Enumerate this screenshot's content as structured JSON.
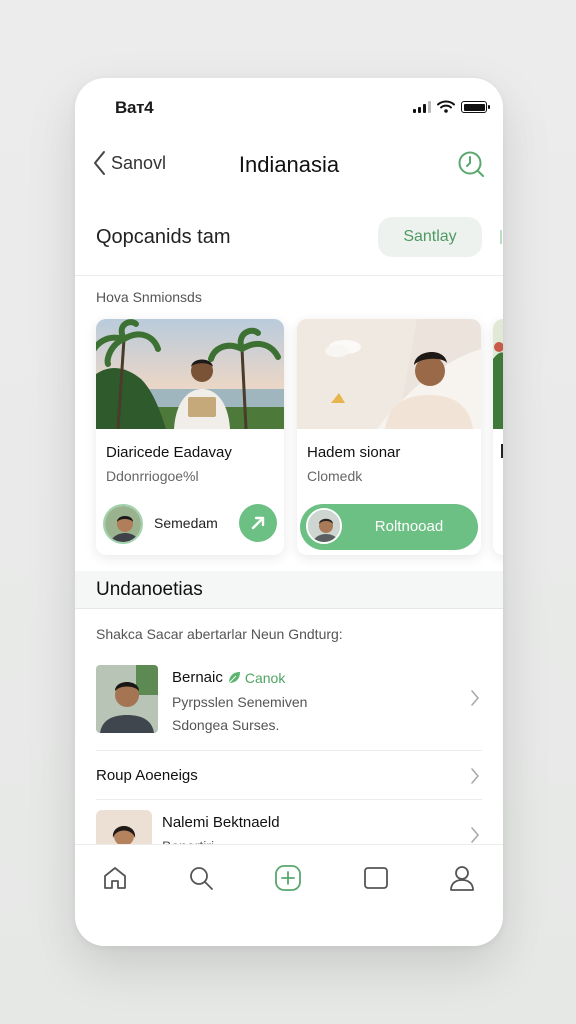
{
  "status_bar": {
    "time": "Baт4"
  },
  "nav": {
    "back_label": "Sanovl",
    "title": "Indianasia"
  },
  "section": {
    "title": "Qopcanids tam",
    "action_label": "Santlay"
  },
  "featured": {
    "label": "Hova Snmionsds",
    "cards": [
      {
        "name": "Diaricede Eadavay",
        "role": "Ddonrriogoe%l",
        "person": "Semedam"
      },
      {
        "name": "Hadem sionar",
        "role": "Clomedk",
        "button": "Roltnooad"
      }
    ]
  },
  "list_section": {
    "title": "Undanoetias",
    "subtitle": "Shakca Sacar abertarlar Neun Gndturg:",
    "items": [
      {
        "name": "Bernaic",
        "badge": "Canok",
        "line1": "Pyrpsslen Senemiven",
        "line2": "Sdongea Surses."
      },
      {
        "title": "Roup Aoeneigs"
      },
      {
        "name": "Nalemi Bektnaeld",
        "line1": "Benertiri"
      }
    ]
  },
  "colors": {
    "accent": "#6cc083",
    "accent_text": "#4f9a63"
  },
  "icons": [
    "back-chevron-icon",
    "timer-icon",
    "arrow-up-right-icon",
    "leaf-icon",
    "chevron-right-icon",
    "home-icon",
    "search-icon",
    "plus-icon",
    "square-icon",
    "profile-icon"
  ]
}
